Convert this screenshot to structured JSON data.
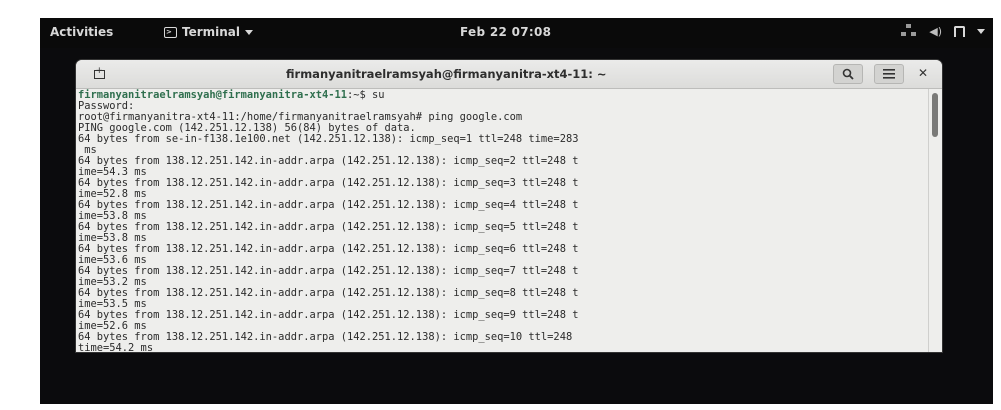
{
  "topbar": {
    "activities": "Activities",
    "app_menu": "Terminal",
    "clock": "Feb 22 07:08"
  },
  "window": {
    "title": "firmanyanitraelramsyah@firmanyanitra-xt4-11: ~"
  },
  "terminal": {
    "prompt_user": "firmanyanitraelramsyah@firmanyanitra-xt4-11",
    "prompt_rest": ":~$ su",
    "lines": [
      "Password:",
      "root@firmanyanitra-xt4-11:/home/firmanyanitraelramsyah# ping google.com",
      "PING google.com (142.251.12.138) 56(84) bytes of data.",
      "64 bytes from se-in-f138.1e100.net (142.251.12.138): icmp_seq=1 ttl=248 time=283",
      " ms",
      "64 bytes from 138.12.251.142.in-addr.arpa (142.251.12.138): icmp_seq=2 ttl=248 t",
      "ime=54.3 ms",
      "64 bytes from 138.12.251.142.in-addr.arpa (142.251.12.138): icmp_seq=3 ttl=248 t",
      "ime=52.8 ms",
      "64 bytes from 138.12.251.142.in-addr.arpa (142.251.12.138): icmp_seq=4 ttl=248 t",
      "ime=53.8 ms",
      "64 bytes from 138.12.251.142.in-addr.arpa (142.251.12.138): icmp_seq=5 ttl=248 t",
      "ime=53.8 ms",
      "64 bytes from 138.12.251.142.in-addr.arpa (142.251.12.138): icmp_seq=6 ttl=248 t",
      "ime=53.6 ms",
      "64 bytes from 138.12.251.142.in-addr.arpa (142.251.12.138): icmp_seq=7 ttl=248 t",
      "ime=53.2 ms",
      "64 bytes from 138.12.251.142.in-addr.arpa (142.251.12.138): icmp_seq=8 ttl=248 t",
      "ime=53.5 ms",
      "64 bytes from 138.12.251.142.in-addr.arpa (142.251.12.138): icmp_seq=9 ttl=248 t",
      "ime=52.6 ms",
      "64 bytes from 138.12.251.142.in-addr.arpa (142.251.12.138): icmp_seq=10 ttl=248",
      "time=54.2 ms"
    ]
  }
}
